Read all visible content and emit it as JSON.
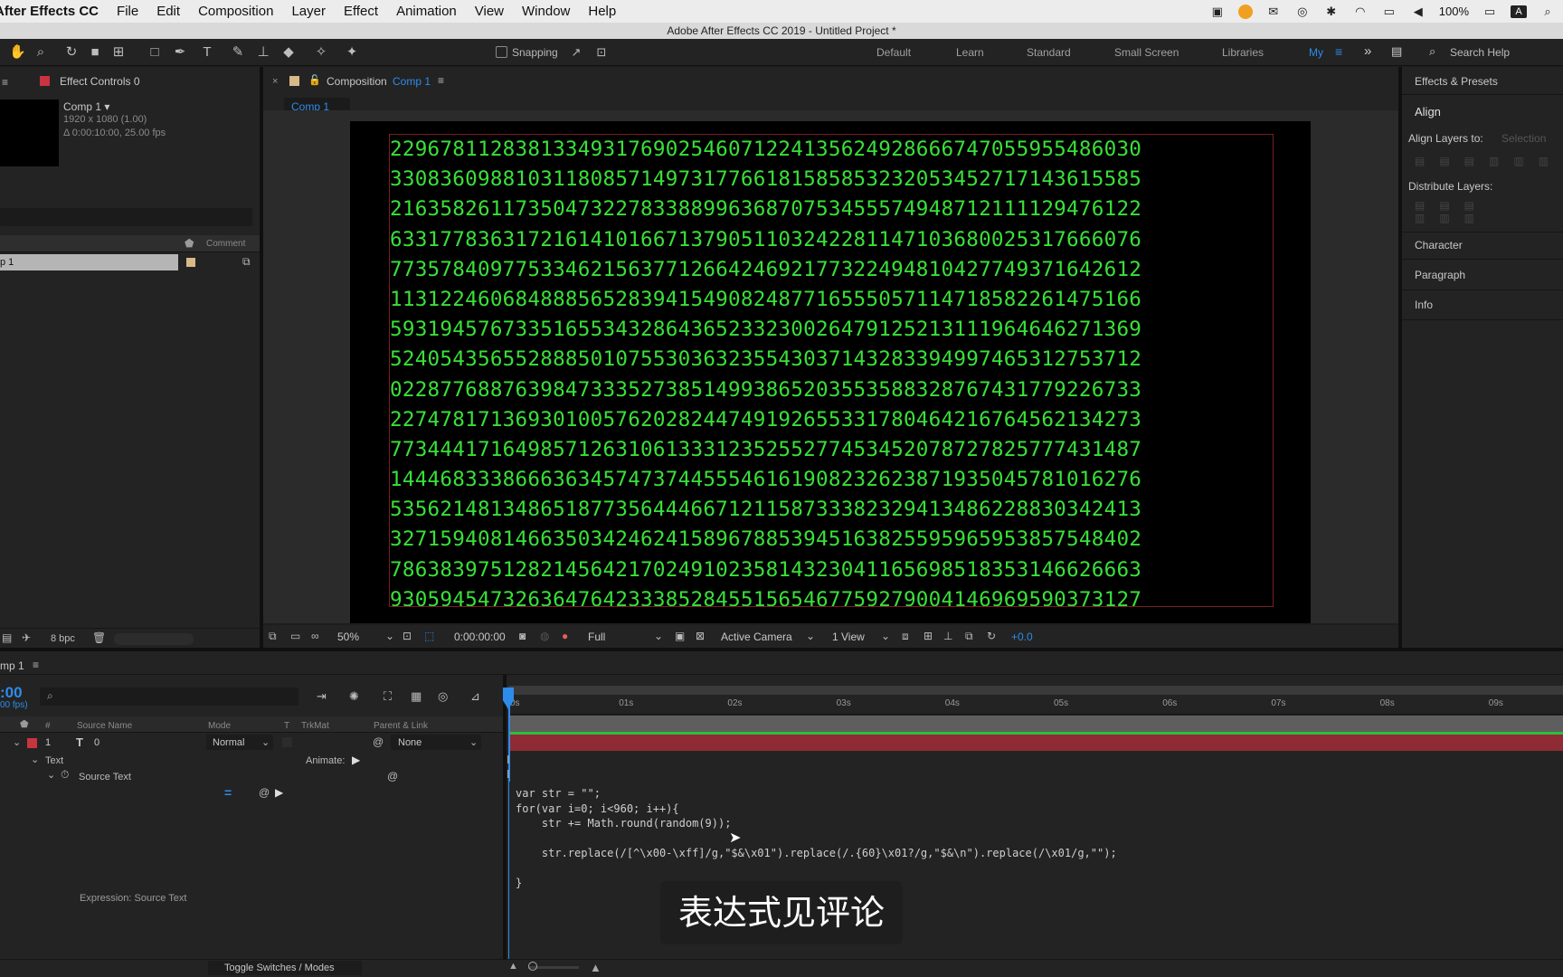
{
  "menubar": {
    "app": "After Effects CC",
    "items": [
      "File",
      "Edit",
      "Composition",
      "Layer",
      "Effect",
      "Animation",
      "View",
      "Window",
      "Help"
    ],
    "battery": "100%",
    "input_source": "A"
  },
  "title": "Adobe After Effects CC 2019 - Untitled Project *",
  "toolbar": {
    "snapping": "Snapping",
    "workspaces": [
      "Default",
      "Learn",
      "Standard",
      "Small Screen",
      "Libraries",
      "My"
    ],
    "search_help": "Search Help"
  },
  "project_panel": {
    "effect_controls": "Effect Controls 0",
    "comp_name": "Comp 1 ▾",
    "comp_res": "1920 x 1080 (1.00)",
    "comp_dur": "Δ 0:00:10:00, 25.00 fps",
    "comment_col": "Comment",
    "row_item": "p 1",
    "bpc": "8 bpc"
  },
  "composition_panel": {
    "title": "Composition",
    "comp_link": "Comp 1",
    "tab": "Comp 1",
    "zoom": "50%",
    "timecode": "0:00:00:00",
    "resolution": "Full",
    "camera": "Active Camera",
    "views": "1 View",
    "exposure": "+0.0"
  },
  "digit_rows": [
    "229678112838133493176902546071224135624928666747055955486030",
    "330836098810311808571497317766181585853232053452717143615585",
    "216358261173504732278338899636870753455574948712111129476122",
    "633177836317216141016671379051103242281147103680025317666076",
    "773578409775334621563771266424692177322494810427749371642612",
    "113122460684888565283941549082487716555057114718582261475166",
    "593194576733516553432864365233230026479125213111964646271369",
    "524054356552888501075530363235543037143283394997465312753712",
    "022877688763984733352738514993865203553588328767431779226733",
    "227478171369301005762028244749192655331780464216764562134273",
    "773444171649857126310613331235255277453452078727825777431487",
    "144468333866636345747374455546161908232623871935045781016276",
    "535621481348651877356444667121158733382329413486228830342413",
    "327159408146635034246241589678853945163825595965953857548402",
    "786383975128214564217024910235814323041165698518353146626663",
    "930594547326364764233385284551565467759279004146969590373127"
  ],
  "right_panel": {
    "effects_presets": "Effects & Presets",
    "align": "Align",
    "align_layers_to": "Align Layers to:",
    "selection": "Selection",
    "distribute_layers": "Distribute Layers:",
    "character": "Character",
    "paragraph": "Paragraph",
    "info": "Info"
  },
  "timeline": {
    "comp_tab": "mp 1",
    "timecode": ":00",
    "fps": "00 fps)",
    "columns": {
      "num": "#",
      "source": "Source Name",
      "mode": "Mode",
      "t": "T",
      "trkmat": "TrkMat",
      "parent": "Parent & Link"
    },
    "layer": {
      "num": "1",
      "name": "0",
      "mode": "Normal",
      "parent": "None"
    },
    "text_group": "Text",
    "animate": "Animate:",
    "source_text": "Source Text",
    "expression_label": "Expression: Source Text",
    "ruler": [
      "0s",
      "01s",
      "02s",
      "03s",
      "04s",
      "05s",
      "06s",
      "07s",
      "08s",
      "09s"
    ],
    "toggle": "Toggle Switches / Modes"
  },
  "expression_lines": [
    "var str = \"\";",
    "for(var i=0; i<960; i++){",
    "    str += Math.round(random(9));",
    "",
    "    str.replace(/[^\\x00-\\xff]/g,\"$&\\x01\").replace(/.{60}\\x01?/g,\"$&\\n\").replace(/\\x01/g,\"\");",
    "",
    "}"
  ],
  "subtitle": "表达式见评论",
  "colors": {
    "accent": "#2d8ceb",
    "digits": "#39e03a",
    "layer_bar": "#8e2b34",
    "label_red": "#c8343f"
  }
}
